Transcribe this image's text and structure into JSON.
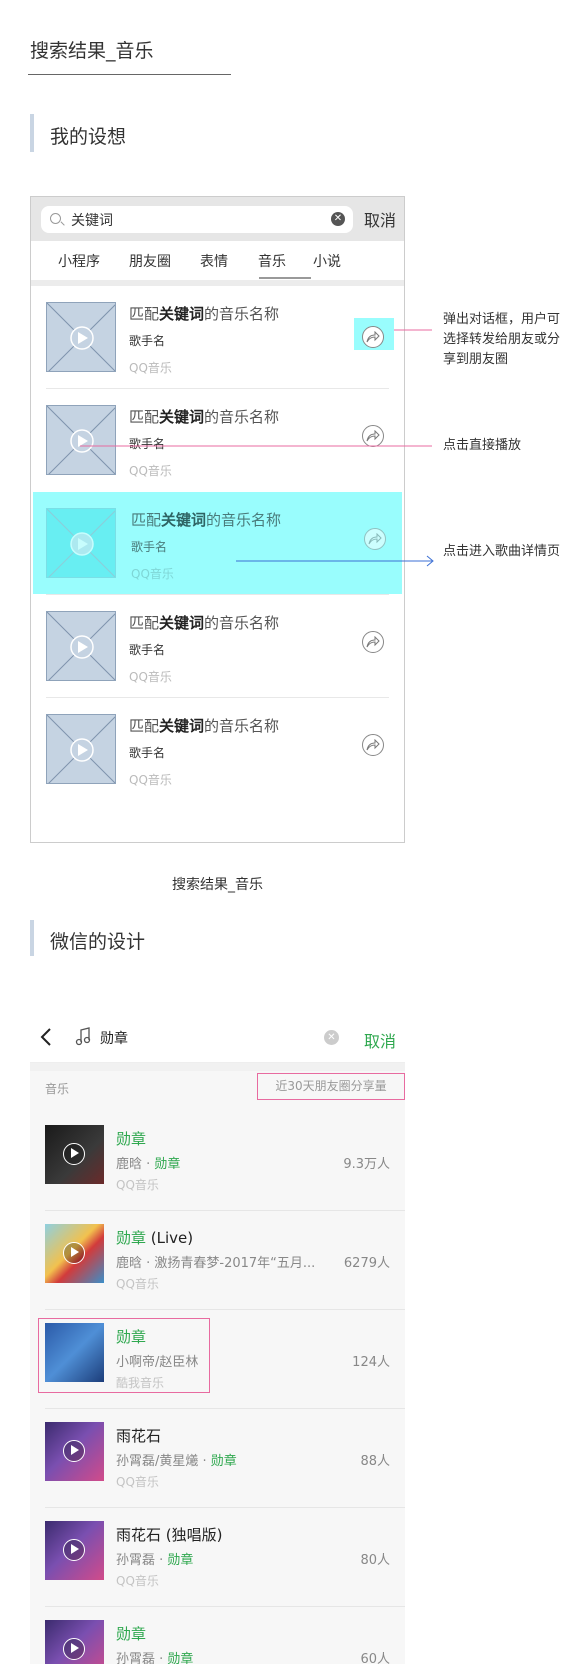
{
  "page_title": "搜索结果_音乐",
  "section1_title": "我的设想",
  "mockup1": {
    "search_keyword": "关键词",
    "cancel_label": "取消",
    "tabs": [
      "小程序",
      "朋友圈",
      "表情",
      "音乐",
      "小说"
    ],
    "active_tab": "音乐",
    "results": [
      {
        "title_prefix": "匹配",
        "title_keyword": "关键词",
        "title_suffix": "的音乐名称",
        "artist": "歌手名",
        "source": "QQ音乐"
      },
      {
        "title_prefix": "匹配",
        "title_keyword": "关键词",
        "title_suffix": "的音乐名称",
        "artist": "歌手名",
        "source": "QQ音乐"
      },
      {
        "title_prefix": "匹配",
        "title_keyword": "关键词",
        "title_suffix": "的音乐名称",
        "artist": "歌手名",
        "source": "QQ音乐"
      },
      {
        "title_prefix": "匹配",
        "title_keyword": "关键词",
        "title_suffix": "的音乐名称",
        "artist": "歌手名",
        "source": "QQ音乐"
      },
      {
        "title_prefix": "匹配",
        "title_keyword": "关键词",
        "title_suffix": "的音乐名称",
        "artist": "歌手名",
        "source": "QQ音乐"
      }
    ]
  },
  "annotations": {
    "share": "弹出对话框，用户可选择转发给朋友或分享到朋友圈",
    "play": "点击直接播放",
    "detail": "点击进入歌曲详情页"
  },
  "caption": "搜索结果_音乐",
  "section2_title": "微信的设计",
  "mockup2": {
    "search_keyword": "勋章",
    "cancel_label": "取消",
    "list_label": "音乐",
    "share_hint": "近30天朋友圈分享量",
    "results": [
      {
        "title": "勋章",
        "title_extra": "",
        "artist": "鹿晗",
        "artist_keyword": "勋章",
        "source": "QQ音乐",
        "count": "9.3万人"
      },
      {
        "title": "勋章",
        "title_extra": " (Live)",
        "artist": "鹿晗 · 激扬青春梦-2017年“五月...",
        "artist_keyword": "",
        "source": "QQ音乐",
        "count": "6279人"
      },
      {
        "title": "勋章",
        "title_extra": "",
        "artist": "小啊帝/赵臣林",
        "artist_keyword": "",
        "source": "酷我音乐",
        "count": "124人"
      },
      {
        "title": "雨花石",
        "title_extra": "",
        "artist": "孙霄磊/黄星爔",
        "artist_keyword": "勋章",
        "source": "QQ音乐",
        "count": "88人"
      },
      {
        "title": "雨花石 (独唱版)",
        "title_extra": "",
        "artist": "孙霄磊",
        "artist_keyword": "勋章",
        "source": "QQ音乐",
        "count": "80人"
      },
      {
        "title": "勋章",
        "title_extra": "",
        "artist": "孙霄磊",
        "artist_keyword": "勋章",
        "source": "",
        "count": "60人"
      }
    ]
  },
  "colors": {
    "highlight": "#99fdfd",
    "accent_green": "#2fa84f",
    "annotation_pink": "#e86ba0",
    "annotation_blue": "#3b6fd4"
  }
}
